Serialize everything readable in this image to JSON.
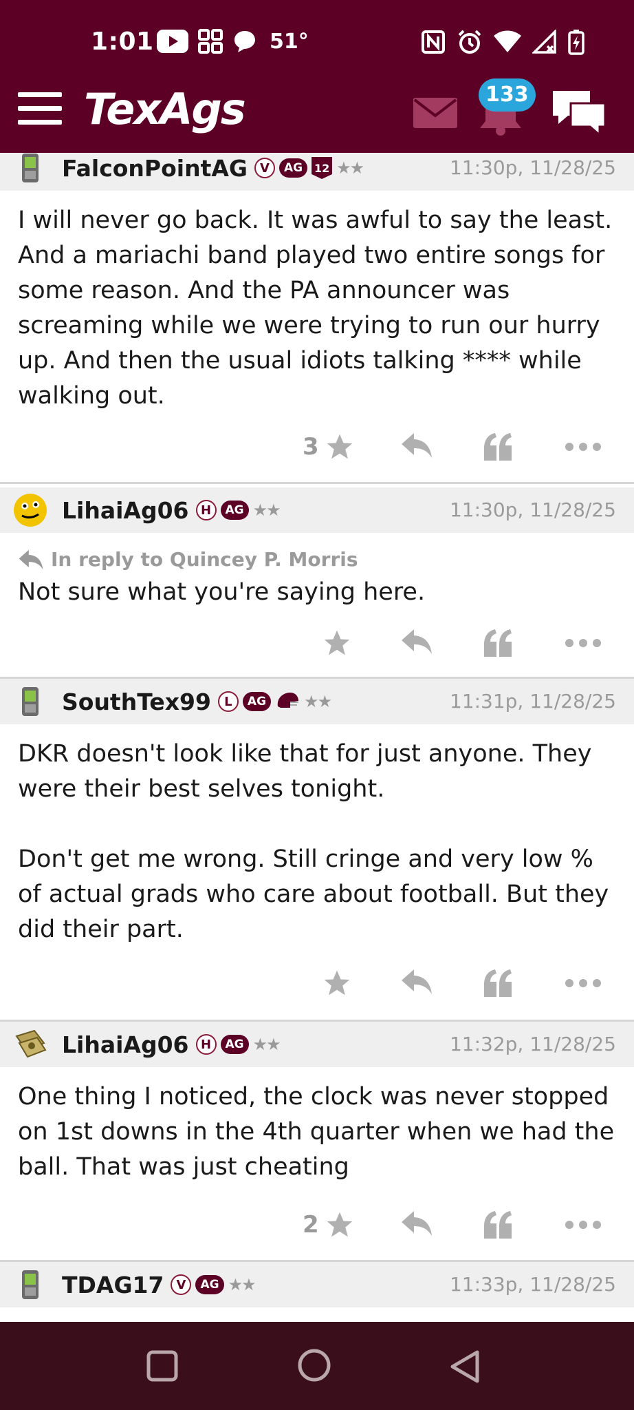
{
  "status_bar": {
    "time": "1:01",
    "temperature": "51°"
  },
  "header": {
    "logo": "TexAgs",
    "notification_count": "133"
  },
  "posts": [
    {
      "username": "FalconPointAG",
      "avatar_icon": "phone-icon",
      "badges": [
        "V",
        "AG",
        "12"
      ],
      "timestamp": "11:30p, 11/28/25",
      "body": "I will never go back. It was awful to say the least. And a mariachi band played two entire songs for some reason. And the PA announcer was screaming while we were trying to run our hurry up. And then the usual idiots talking **** while walking out.",
      "star_count": "3"
    },
    {
      "username": "LihaiAg06",
      "avatar_icon": "emoji-face-icon",
      "badges": [
        "H",
        "AG"
      ],
      "timestamp": "11:30p, 11/28/25",
      "reply_to": "In reply to Quincey P. Morris",
      "body": "Not sure what you're saying here.",
      "star_count": ""
    },
    {
      "username": "SouthTex99",
      "avatar_icon": "phone-icon",
      "badges": [
        "L",
        "AG"
      ],
      "timestamp": "11:31p, 11/28/25",
      "body": "DKR doesn't look like that for just anyone. They were their best selves tonight.\n\nDon't get me wrong. Still cringe and very low % of actual grads who care about football. But they did their part.",
      "star_count": ""
    },
    {
      "username": "LihaiAg06",
      "avatar_icon": "money-icon",
      "badges": [
        "H",
        "AG"
      ],
      "timestamp": "11:32p, 11/28/25",
      "body": "One thing I noticed, the clock was never stopped on 1st downs in the 4th quarter when we had the ball. That was just cheating",
      "star_count": "2"
    },
    {
      "username": "TDAG17",
      "avatar_icon": "phone-icon",
      "badges": [
        "V",
        "AG"
      ],
      "timestamp": "11:33p, 11/28/25"
    }
  ],
  "colors": {
    "maroon": "#5c0025",
    "badge_blue": "#2ba6dd",
    "nav_bg": "#3a0f1b"
  }
}
